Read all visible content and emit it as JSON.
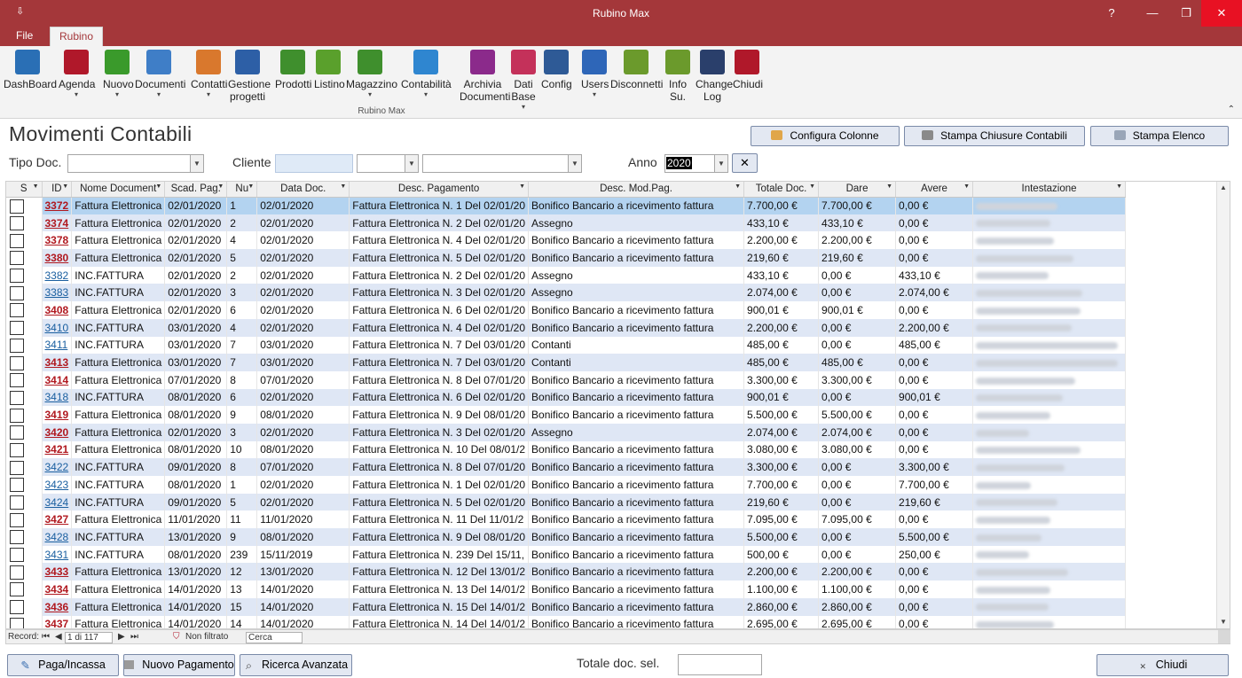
{
  "window": {
    "title": "Rubino Max",
    "help": "?",
    "minimize": "—",
    "restore": "❐",
    "close": "✕",
    "qat": "⇩"
  },
  "tabs": [
    {
      "label": "File"
    },
    {
      "label": "Rubino"
    }
  ],
  "ribbon": {
    "buttons": [
      {
        "label": "DashBoard",
        "icon": "monitor-icon",
        "color": "#2a6fb5"
      },
      {
        "label": "Agenda",
        "icon": "notebook-icon",
        "color": "#b0182a",
        "dropdown": "▾"
      },
      {
        "label": "Nuovo",
        "icon": "new-badge-icon",
        "color": "#3a9a2b",
        "dropdown": "▾"
      },
      {
        "label": "Documenti",
        "icon": "document-icon",
        "color": "#3f7ec7",
        "dropdown": "▾"
      },
      {
        "label": "Contatti",
        "icon": "people-icon",
        "color": "#d9782d",
        "dropdown": "▾"
      },
      {
        "label": "Gestione\nprogetti",
        "icon": "project-card-icon",
        "color": "#2d5fa6"
      },
      {
        "label": "Prodotti",
        "icon": "box-icon",
        "color": "#3f8f2d"
      },
      {
        "label": "Listino",
        "icon": "banknote-icon",
        "color": "#5aa02c"
      },
      {
        "label": "Magazzino",
        "icon": "cart-icon",
        "color": "#3f8f2d",
        "dropdown": "▾"
      },
      {
        "label": "Contabilità",
        "icon": "euro-bag-icon",
        "color": "#2f86d0",
        "dropdown": "▾"
      },
      {
        "label": "Archivia\nDocumenti",
        "icon": "briefcase-icon",
        "color": "#8b2a8b"
      },
      {
        "label": "Dati\nBase",
        "icon": "database-icon",
        "color": "#c4315a",
        "dropdown": "▾"
      },
      {
        "label": "Config",
        "icon": "tools-icon",
        "color": "#2e5a96"
      },
      {
        "label": "Users",
        "icon": "users-icon",
        "color": "#2e66b8",
        "dropdown": "▾"
      },
      {
        "label": "Disconnetti",
        "icon": "key-icon",
        "color": "#6b9a2c"
      },
      {
        "label": "Info\nSu.",
        "icon": "info-icon",
        "color": "#6b9a2c"
      },
      {
        "label": "Change\nLog",
        "icon": "globe-icon",
        "color": "#2a3f6b"
      },
      {
        "label": "Chiudi",
        "icon": "exit-icon",
        "color": "#b0182a"
      }
    ],
    "group_label": "Rubino Max",
    "collapse": "⌃"
  },
  "form": {
    "title": "Movimenti Contabili",
    "buttons": {
      "configura": "Configura Colonne",
      "stampa_chiusure": "Stampa Chiusure Contabili",
      "stampa_elenco": "Stampa Elenco"
    },
    "filters": {
      "tipo_doc_label": "Tipo Doc.",
      "cliente_label": "Cliente",
      "anno_label": "Anno",
      "anno_value": "2020",
      "clear": "✕"
    }
  },
  "grid": {
    "columns": [
      "S",
      "ID",
      "Nome Document",
      "Scad. Pag.",
      "Nu",
      "Data Doc.",
      "Desc. Pagamento",
      "Desc. Mod.Pag.",
      "Totale Doc.",
      "Dare",
      "Avere",
      "Intestazione"
    ],
    "rows": [
      {
        "id": "3372",
        "bold": true,
        "nome": "Fattura Elettronica",
        "scad": "02/01/2020",
        "num": "1",
        "data": "02/01/2020",
        "desc": "Fattura Elettronica N. 1 Del 02/01/20",
        "mod": "Bonifico Bancario a ricevimento fattura",
        "tot": "7.700,00 €",
        "dare": "7.700,00 €",
        "avere": "0,00 €"
      },
      {
        "id": "3374",
        "bold": true,
        "nome": "Fattura Elettronica",
        "scad": "02/01/2020",
        "num": "2",
        "data": "02/01/2020",
        "desc": "Fattura Elettronica N. 2 Del 02/01/20",
        "mod": "Assegno",
        "tot": "433,10 €",
        "dare": "433,10 €",
        "avere": "0,00 €"
      },
      {
        "id": "3378",
        "bold": true,
        "nome": "Fattura Elettronica",
        "scad": "02/01/2020",
        "num": "4",
        "data": "02/01/2020",
        "desc": "Fattura Elettronica N. 4 Del 02/01/20",
        "mod": "Bonifico Bancario a ricevimento fattura",
        "tot": "2.200,00 €",
        "dare": "2.200,00 €",
        "avere": "0,00 €"
      },
      {
        "id": "3380",
        "bold": true,
        "nome": "Fattura Elettronica",
        "scad": "02/01/2020",
        "num": "5",
        "data": "02/01/2020",
        "desc": "Fattura Elettronica N. 5 Del 02/01/20",
        "mod": "Bonifico Bancario a ricevimento fattura",
        "tot": "219,60 €",
        "dare": "219,60 €",
        "avere": "0,00 €"
      },
      {
        "id": "3382",
        "bold": false,
        "nome": "INC.FATTURA",
        "scad": "02/01/2020",
        "num": "2",
        "data": "02/01/2020",
        "desc": "Fattura Elettronica N. 2 Del 02/01/20",
        "mod": "Assegno",
        "tot": "433,10 €",
        "dare": "0,00 €",
        "avere": "433,10 €"
      },
      {
        "id": "3383",
        "bold": false,
        "nome": "INC.FATTURA",
        "scad": "02/01/2020",
        "num": "3",
        "data": "02/01/2020",
        "desc": "Fattura Elettronica N. 3 Del 02/01/20",
        "mod": "Assegno",
        "tot": "2.074,00 €",
        "dare": "0,00 €",
        "avere": "2.074,00 €"
      },
      {
        "id": "3408",
        "bold": true,
        "nome": "Fattura Elettronica",
        "scad": "02/01/2020",
        "num": "6",
        "data": "02/01/2020",
        "desc": "Fattura Elettronica N. 6 Del 02/01/20",
        "mod": "Bonifico Bancario a ricevimento fattura",
        "tot": "900,01 €",
        "dare": "900,01 €",
        "avere": "0,00 €"
      },
      {
        "id": "3410",
        "bold": false,
        "nome": "INC.FATTURA",
        "scad": "03/01/2020",
        "num": "4",
        "data": "02/01/2020",
        "desc": "Fattura Elettronica N. 4 Del 02/01/20",
        "mod": "Bonifico Bancario a ricevimento fattura",
        "tot": "2.200,00 €",
        "dare": "0,00 €",
        "avere": "2.200,00 €"
      },
      {
        "id": "3411",
        "bold": false,
        "nome": "INC.FATTURA",
        "scad": "03/01/2020",
        "num": "7",
        "data": "03/01/2020",
        "desc": "Fattura Elettronica N. 7 Del 03/01/20",
        "mod": "Contanti",
        "tot": "485,00 €",
        "dare": "0,00 €",
        "avere": "485,00 €"
      },
      {
        "id": "3413",
        "bold": true,
        "nome": "Fattura Elettronica",
        "scad": "03/01/2020",
        "num": "7",
        "data": "03/01/2020",
        "desc": "Fattura Elettronica N. 7 Del 03/01/20",
        "mod": "Contanti",
        "tot": "485,00 €",
        "dare": "485,00 €",
        "avere": "0,00 €"
      },
      {
        "id": "3414",
        "bold": true,
        "nome": "Fattura Elettronica",
        "scad": "07/01/2020",
        "num": "8",
        "data": "07/01/2020",
        "desc": "Fattura Elettronica N. 8 Del 07/01/20",
        "mod": "Bonifico Bancario a ricevimento fattura",
        "tot": "3.300,00 €",
        "dare": "3.300,00 €",
        "avere": "0,00 €"
      },
      {
        "id": "3418",
        "bold": false,
        "nome": "INC.FATTURA",
        "scad": "08/01/2020",
        "num": "6",
        "data": "02/01/2020",
        "desc": "Fattura Elettronica N. 6 Del 02/01/20",
        "mod": "Bonifico Bancario a ricevimento fattura",
        "tot": "900,01 €",
        "dare": "0,00 €",
        "avere": "900,01 €"
      },
      {
        "id": "3419",
        "bold": true,
        "nome": "Fattura Elettronica",
        "scad": "08/01/2020",
        "num": "9",
        "data": "08/01/2020",
        "desc": "Fattura Elettronica N. 9 Del 08/01/20",
        "mod": "Bonifico Bancario a ricevimento fattura",
        "tot": "5.500,00 €",
        "dare": "5.500,00 €",
        "avere": "0,00 €"
      },
      {
        "id": "3420",
        "bold": true,
        "nome": "Fattura Elettronica",
        "scad": "02/01/2020",
        "num": "3",
        "data": "02/01/2020",
        "desc": "Fattura Elettronica N. 3 Del 02/01/20",
        "mod": "Assegno",
        "tot": "2.074,00 €",
        "dare": "2.074,00 €",
        "avere": "0,00 €"
      },
      {
        "id": "3421",
        "bold": true,
        "nome": "Fattura Elettronica",
        "scad": "08/01/2020",
        "num": "10",
        "data": "08/01/2020",
        "desc": "Fattura Elettronica N. 10 Del 08/01/2",
        "mod": "Bonifico Bancario a ricevimento fattura",
        "tot": "3.080,00 €",
        "dare": "3.080,00 €",
        "avere": "0,00 €"
      },
      {
        "id": "3422",
        "bold": false,
        "nome": "INC.FATTURA",
        "scad": "09/01/2020",
        "num": "8",
        "data": "07/01/2020",
        "desc": "Fattura Elettronica N. 8 Del 07/01/20",
        "mod": "Bonifico Bancario a ricevimento fattura",
        "tot": "3.300,00 €",
        "dare": "0,00 €",
        "avere": "3.300,00 €"
      },
      {
        "id": "3423",
        "bold": false,
        "nome": "INC.FATTURA",
        "scad": "08/01/2020",
        "num": "1",
        "data": "02/01/2020",
        "desc": "Fattura Elettronica N. 1 Del 02/01/20",
        "mod": "Bonifico Bancario a ricevimento fattura",
        "tot": "7.700,00 €",
        "dare": "0,00 €",
        "avere": "7.700,00 €"
      },
      {
        "id": "3424",
        "bold": false,
        "nome": "INC.FATTURA",
        "scad": "09/01/2020",
        "num": "5",
        "data": "02/01/2020",
        "desc": "Fattura Elettronica N. 5 Del 02/01/20",
        "mod": "Bonifico Bancario a ricevimento fattura",
        "tot": "219,60 €",
        "dare": "0,00 €",
        "avere": "219,60 €"
      },
      {
        "id": "3427",
        "bold": true,
        "nome": "Fattura Elettronica",
        "scad": "11/01/2020",
        "num": "11",
        "data": "11/01/2020",
        "desc": "Fattura Elettronica N. 11 Del 11/01/2",
        "mod": "Bonifico Bancario a ricevimento fattura",
        "tot": "7.095,00 €",
        "dare": "7.095,00 €",
        "avere": "0,00 €"
      },
      {
        "id": "3428",
        "bold": false,
        "nome": "INC.FATTURA",
        "scad": "13/01/2020",
        "num": "9",
        "data": "08/01/2020",
        "desc": "Fattura Elettronica N. 9 Del 08/01/20",
        "mod": "Bonifico Bancario a ricevimento fattura",
        "tot": "5.500,00 €",
        "dare": "0,00 €",
        "avere": "5.500,00 €"
      },
      {
        "id": "3431",
        "bold": false,
        "nome": "INC.FATTURA",
        "scad": "08/01/2020",
        "num": "239",
        "data": "15/11/2019",
        "desc": "Fattura Elettronica N. 239 Del 15/11,",
        "mod": "Bonifico Bancario a ricevimento fattura",
        "tot": "500,00 €",
        "dare": "0,00 €",
        "avere": "250,00 €"
      },
      {
        "id": "3433",
        "bold": true,
        "nome": "Fattura Elettronica",
        "scad": "13/01/2020",
        "num": "12",
        "data": "13/01/2020",
        "desc": "Fattura Elettronica N. 12 Del 13/01/2",
        "mod": "Bonifico Bancario a ricevimento fattura",
        "tot": "2.200,00 €",
        "dare": "2.200,00 €",
        "avere": "0,00 €"
      },
      {
        "id": "3434",
        "bold": true,
        "nome": "Fattura Elettronica",
        "scad": "14/01/2020",
        "num": "13",
        "data": "14/01/2020",
        "desc": "Fattura Elettronica N. 13 Del 14/01/2",
        "mod": "Bonifico Bancario a ricevimento fattura",
        "tot": "1.100,00 €",
        "dare": "1.100,00 €",
        "avere": "0,00 €"
      },
      {
        "id": "3436",
        "bold": true,
        "nome": "Fattura Elettronica",
        "scad": "14/01/2020",
        "num": "15",
        "data": "14/01/2020",
        "desc": "Fattura Elettronica N. 15 Del 14/01/2",
        "mod": "Bonifico Bancario a ricevimento fattura",
        "tot": "2.860,00 €",
        "dare": "2.860,00 €",
        "avere": "0,00 €"
      },
      {
        "id": "3437",
        "bold": true,
        "nome": "Fattura Elettronica",
        "scad": "14/01/2020",
        "num": "14",
        "data": "14/01/2020",
        "desc": "Fattura Elettronica N. 14 Del 14/01/2",
        "mod": "Bonifico Bancario a ricevimento fattura",
        "tot": "2.695,00 €",
        "dare": "2.695,00 €",
        "avere": "0,00 €"
      }
    ]
  },
  "record_nav": {
    "label": "Record:",
    "first": "⏮",
    "prev": "◀",
    "position": "1 di 117",
    "next": "▶",
    "last": "⏭",
    "filter": "Non filtrato",
    "search": "Cerca"
  },
  "footer": {
    "paga": "Paga/Incassa",
    "nuovo_pagamento": "Nuovo Pagamento",
    "ricerca": "Ricerca Avanzata",
    "totale_label": "Totale doc. sel.",
    "chiudi": "Chiudi"
  }
}
